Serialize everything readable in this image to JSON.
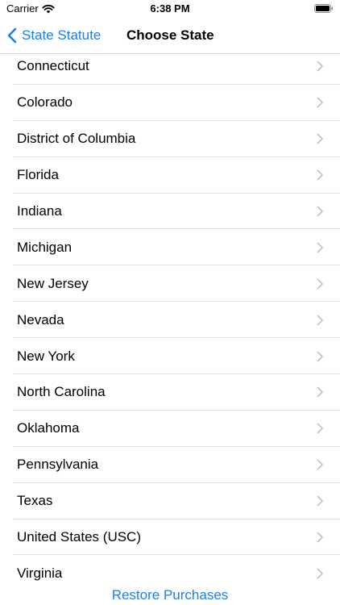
{
  "status_bar": {
    "carrier": "Carrier",
    "time": "6:38 PM",
    "icons": [
      "wifi-icon",
      "battery-icon"
    ]
  },
  "nav": {
    "back_label": "State Statute",
    "back_icon": "chevron-left-icon",
    "title": "Choose State",
    "accent_color": "#1a7ff2"
  },
  "states": [
    {
      "label": "Connecticut"
    },
    {
      "label": "Colorado"
    },
    {
      "label": "District of Columbia"
    },
    {
      "label": "Florida"
    },
    {
      "label": "Indiana"
    },
    {
      "label": "Michigan"
    },
    {
      "label": "New Jersey"
    },
    {
      "label": "Nevada"
    },
    {
      "label": "New York"
    },
    {
      "label": "North Carolina"
    },
    {
      "label": "Oklahoma"
    },
    {
      "label": "Pennsylvania"
    },
    {
      "label": "Texas"
    },
    {
      "label": "United States (USC)"
    },
    {
      "label": "Virginia"
    }
  ],
  "row_icon": "chevron-right-icon",
  "footer": {
    "restore_label": "Restore Purchases"
  }
}
